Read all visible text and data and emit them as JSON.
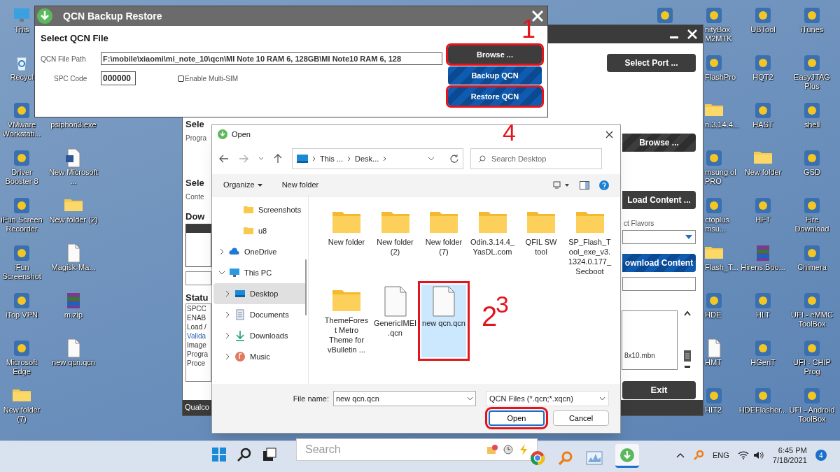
{
  "desktop": {
    "columns": [
      [
        {
          "label": "This",
          "kind": "pc"
        },
        {
          "label": "Recycl",
          "kind": "bin"
        },
        {
          "label": "VMware Workstati...",
          "kind": "app"
        },
        {
          "label": "Driver Booster 8",
          "kind": "app"
        },
        {
          "label": "iFun Screen Recorder",
          "kind": "app"
        },
        {
          "label": "iFun Screenshot",
          "kind": "app"
        },
        {
          "label": "iTop VPN",
          "kind": "app"
        },
        {
          "label": "Microsoft Edge",
          "kind": "app"
        },
        {
          "label": "New folder (7)",
          "kind": "folder"
        }
      ],
      [
        {
          "label": "psiphon3.exe",
          "kind": "covered"
        },
        {
          "label": "New Microsoft ...",
          "kind": "doc"
        },
        {
          "label": "New folder (2)",
          "kind": "folder"
        },
        {
          "label": "Magisk-Ma...",
          "kind": "file"
        },
        {
          "label": "m.zip",
          "kind": "zip"
        },
        {
          "label": "new qcn.qcn",
          "kind": "file"
        }
      ],
      [
        {
          "kind": "app"
        }
      ],
      [
        {
          "label": "nityBox M2MTK",
          "kind": "app"
        },
        {
          "label": "FlashPro",
          "kind": "app"
        },
        {
          "label": "n.3.14.4...",
          "kind": "folder"
        },
        {
          "label": "msung ol PRO",
          "kind": "app"
        },
        {
          "label": "ctoplus msu...",
          "kind": "app"
        },
        {
          "label": "Flash_T...",
          "kind": "folder"
        },
        {
          "label": "HDE",
          "kind": "app"
        },
        {
          "label": "HMT",
          "kind": "file"
        },
        {
          "label": "HIT2",
          "kind": "app"
        }
      ],
      [
        {
          "label": "UBTool",
          "kind": "app"
        },
        {
          "label": "HQT2",
          "kind": "app"
        },
        {
          "label": "HAST",
          "kind": "app"
        },
        {
          "label": "New folder",
          "kind": "folder"
        },
        {
          "label": "HFT",
          "kind": "app"
        },
        {
          "label": "Hirens.Boo...",
          "kind": "zip"
        },
        {
          "label": "HLT",
          "kind": "app"
        },
        {
          "label": "HGenT",
          "kind": "app"
        },
        {
          "label": "HDEFlasher...",
          "kind": "app"
        }
      ],
      [
        {
          "label": "iTunes",
          "kind": "app"
        },
        {
          "label": "EasyJTAG Plus",
          "kind": "app"
        },
        {
          "label": "shell",
          "kind": "app"
        },
        {
          "label": "GSD",
          "kind": "app"
        },
        {
          "label": "Fire Download",
          "kind": "app"
        },
        {
          "label": "Chimera",
          "kind": "app"
        },
        {
          "label": "UFI - eMMC ToolBox",
          "kind": "app"
        },
        {
          "label": "UFI - CHIP Prog",
          "kind": "app"
        },
        {
          "label": "UFI - Android ToolBox",
          "kind": "app"
        }
      ]
    ]
  },
  "main_window": {
    "left": {
      "heading_1": "Sele",
      "label_1": "Progra",
      "heading_2": "Sele",
      "label_2": "Conte",
      "heading_3": "Dow",
      "heading_4": "Statu",
      "status_lines": [
        "SPCC",
        "ENAB",
        "Load /",
        "Valida",
        "Image",
        "Progra",
        "Proce"
      ],
      "footer": "Qualco"
    },
    "right": {
      "select_port": "Select Port ...",
      "browse": "Browse ...",
      "load_content": "Load Content ...",
      "flavors_label": "ct Flavors",
      "download_content": "ownload Content",
      "log_text": "8x10.mbn",
      "exit": "Exit"
    }
  },
  "qcn_dialog": {
    "title": "QCN Backup Restore",
    "heading": "Select QCN File",
    "path_label": "QCN File Path",
    "path_value": "F:\\mobile\\xiaomi\\mi_note_10\\qcn\\MI Note 10 RAM 6, 128GB\\MI Note10 RAM 6, 128",
    "spc_label": "SPC Code",
    "spc_value": "000000",
    "multi_sim": {
      "label": "Enable Multi-SIM",
      "checked": false
    },
    "buttons": [
      {
        "label": "Browse ...",
        "kind": "dark",
        "highlighted": true
      },
      {
        "label": "Backup QCN",
        "kind": "blue",
        "highlighted": false
      },
      {
        "label": "Restore QCN",
        "kind": "blue",
        "highlighted": true
      }
    ]
  },
  "step_marks": [
    "1",
    "4",
    "2",
    "3"
  ],
  "open_dialog": {
    "title": "Open",
    "path": [
      "This ...",
      "Desk..."
    ],
    "search_placeholder": "Search Desktop",
    "organize": "Organize",
    "new_folder": "New folder",
    "nav": [
      {
        "label": "Screenshots",
        "kind": "folder",
        "selected": false
      },
      {
        "label": "u8",
        "kind": "folder",
        "selected": false
      },
      {
        "label": "OneDrive",
        "kind": "cloud",
        "selected": false,
        "expanded": false
      },
      {
        "label": "This PC",
        "kind": "pc",
        "selected": false,
        "expanded": true
      },
      {
        "label": "Desktop",
        "kind": "desktop",
        "selected": true,
        "expanded": false
      },
      {
        "label": "Documents",
        "kind": "docs",
        "selected": false,
        "expanded": false
      },
      {
        "label": "Downloads",
        "kind": "download",
        "selected": false,
        "expanded": false
      },
      {
        "label": "Music",
        "kind": "music",
        "selected": false,
        "expanded": false
      }
    ],
    "files": [
      {
        "name": "New folder",
        "kind": "folder",
        "selected": false
      },
      {
        "name": "New folder (2)",
        "kind": "folder",
        "selected": false
      },
      {
        "name": "New folder (7)",
        "kind": "folder",
        "selected": false
      },
      {
        "name": "Odin.3.14.4_YasDL.com",
        "kind": "folder",
        "selected": false
      },
      {
        "name": "QFIL SW tool",
        "kind": "folder",
        "selected": false
      },
      {
        "name": "SP_Flash_Tool_exe_v3.1324.0.177_Secboot",
        "kind": "folder",
        "selected": false
      },
      {
        "name": "ThemeForest Metro Theme for vBulletin ...",
        "kind": "folder",
        "selected": false
      },
      {
        "name": "GenericIMEI.qcn",
        "kind": "file",
        "selected": false
      },
      {
        "name": "new qcn.qcn",
        "kind": "file",
        "selected": true
      }
    ],
    "file_name_label": "File name:",
    "file_name": "new qcn.qcn",
    "filter": "QCN Files (*.qcn;*.xqcn)",
    "open": "Open",
    "cancel": "Cancel"
  },
  "taskbar": {
    "search_placeholder": "Search",
    "language": "ENG",
    "time": "6:45 PM",
    "date": "7/18/2021",
    "notifications": "4"
  }
}
